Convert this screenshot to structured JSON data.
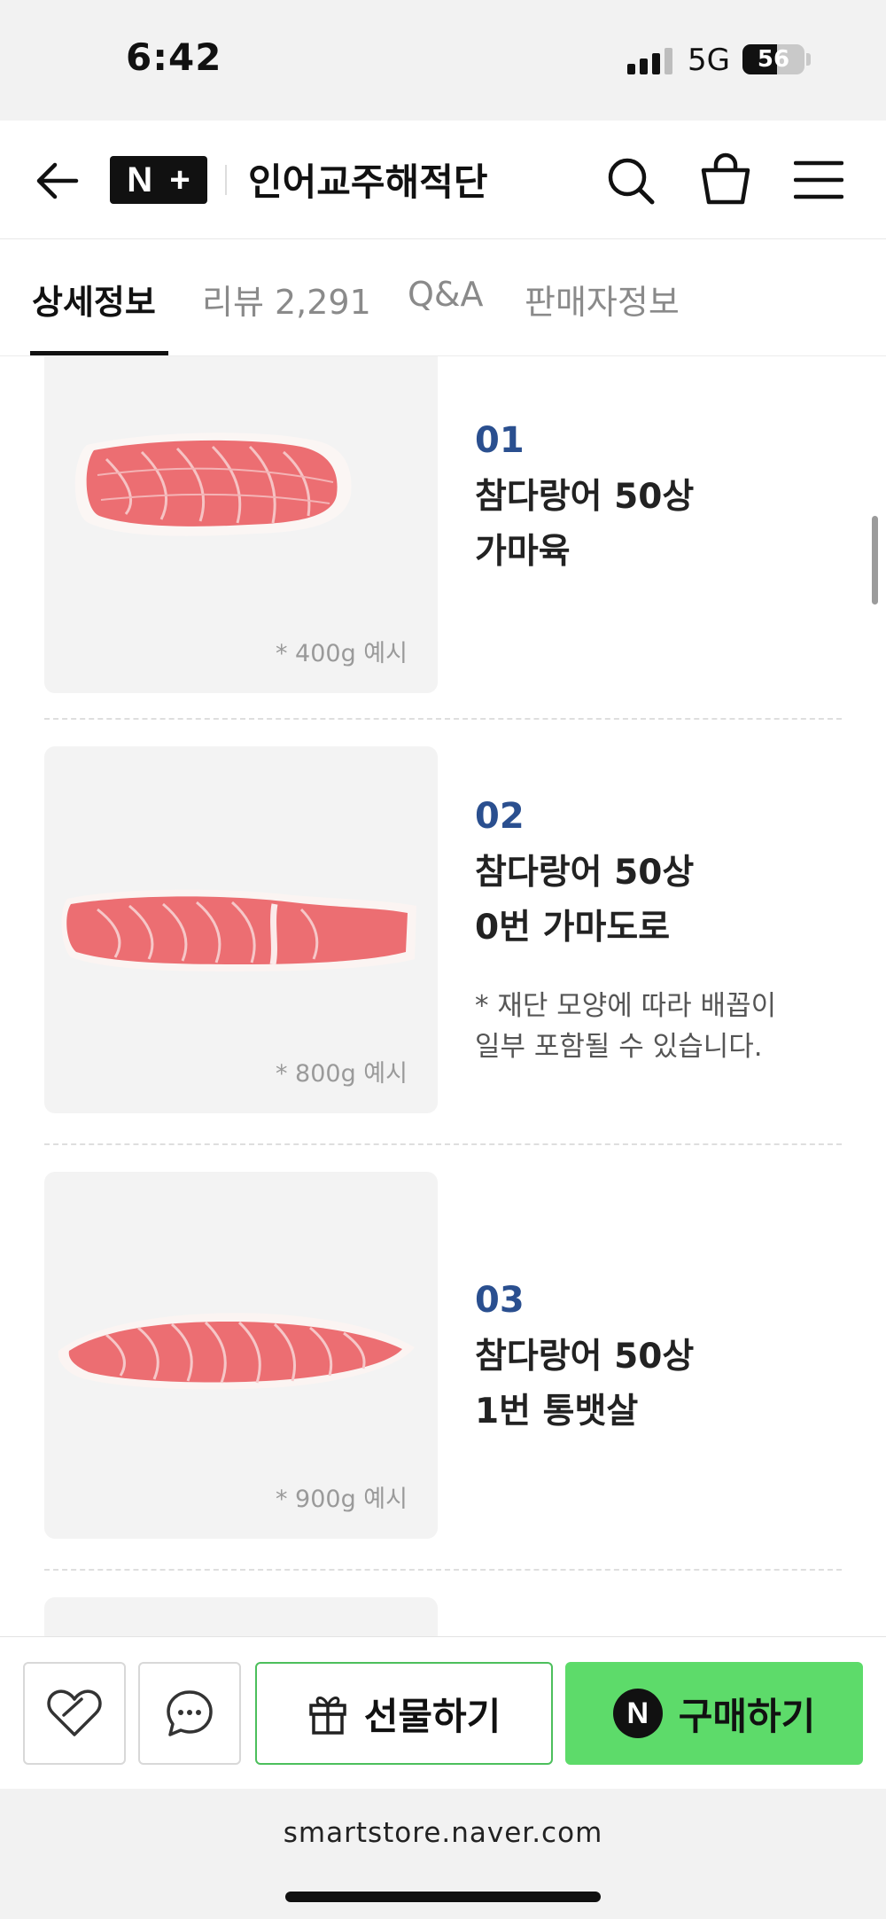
{
  "status_bar": {
    "time": "6:42",
    "network": "5G",
    "battery": "56",
    "battery_level_percent": 56
  },
  "header": {
    "logo": "N+",
    "store_name": "인어교주해적단",
    "icons": [
      "back-arrow-icon",
      "search-icon",
      "shopping-bag-icon",
      "menu-icon"
    ]
  },
  "tabs": [
    {
      "label": "상세정보",
      "active": true
    },
    {
      "label": "리뷰 2,291",
      "active": false
    },
    {
      "label": "Q&A",
      "active": false
    },
    {
      "label": "판매자정보",
      "active": false
    }
  ],
  "products": [
    {
      "number": "01",
      "name_line1": "참다랑어 50상",
      "name_line2": "가마육",
      "note_line1": "",
      "note_line2": "",
      "weight": "* 400g 예시"
    },
    {
      "number": "02",
      "name_line1": "참다랑어 50상",
      "name_line2": "0번 가마도로",
      "note_line1": "* 재단 모양에 따라 배꼽이",
      "note_line2": "일부 포함될 수 있습니다.",
      "weight": "* 800g 예시"
    },
    {
      "number": "03",
      "name_line1": "참다랑어 50상",
      "name_line2": "1번 통뱃살",
      "note_line1": "",
      "note_line2": "",
      "weight": "* 900g 예시"
    }
  ],
  "action_bar": {
    "gift_label": "선물하기",
    "buy_label": "구매하기",
    "buy_badge": "N",
    "icons": [
      "heart-icon",
      "chat-icon",
      "gift-icon"
    ]
  },
  "browser": {
    "url": "smartstore.naver.com"
  },
  "colors": {
    "accent_green": "#5ddb6a",
    "gift_border": "#4cbf5c",
    "item_number_blue": "#2a4f8f",
    "tuna_red": "#ec6e72"
  }
}
